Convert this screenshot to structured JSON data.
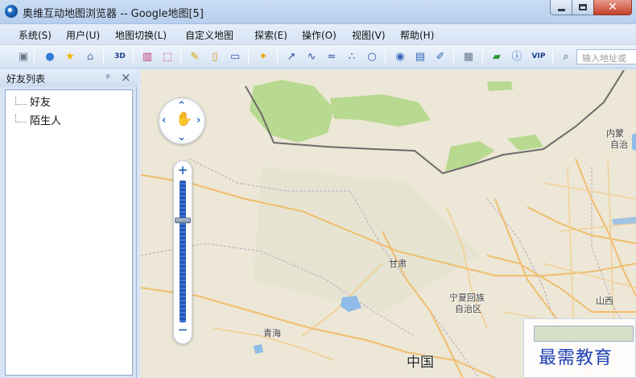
{
  "window": {
    "title": "奥维互动地图浏览器 -- Google地图[5]",
    "controls": {
      "minimize": "minimize",
      "maximize": "maximize",
      "close": "✕"
    }
  },
  "menu": {
    "items": [
      "系统(S)",
      "用户(U)",
      "地图切换(L)",
      "自定义地图",
      "探索(E)",
      "操作(O)",
      "视图(V)",
      "帮助(H)"
    ]
  },
  "toolbar": {
    "three_d_label": "3D",
    "vip_label": "VIP",
    "search_placeholder": "输入地址或"
  },
  "friend_panel": {
    "title": "好友列表",
    "items": [
      "好友",
      "陌生人"
    ]
  },
  "map": {
    "labels": {
      "inner_mongolia": "内蒙",
      "inner_mongolia_suffix": "自治",
      "gansu": "甘肃",
      "ningxia_line1": "宁夏回族",
      "ningxia_line2": "自治区",
      "shanxi": "山西",
      "qinghai": "青海",
      "china": "中国"
    },
    "zoom": {
      "level_fraction": 0.72
    }
  },
  "watermark": {
    "text": "最需教育"
  },
  "colors": {
    "land": "#eae6d8",
    "green_region": "#b6d98a",
    "water": "#8fbce6",
    "road": "#f3c27a",
    "border": "#666666",
    "accent": "#2c67b8"
  }
}
